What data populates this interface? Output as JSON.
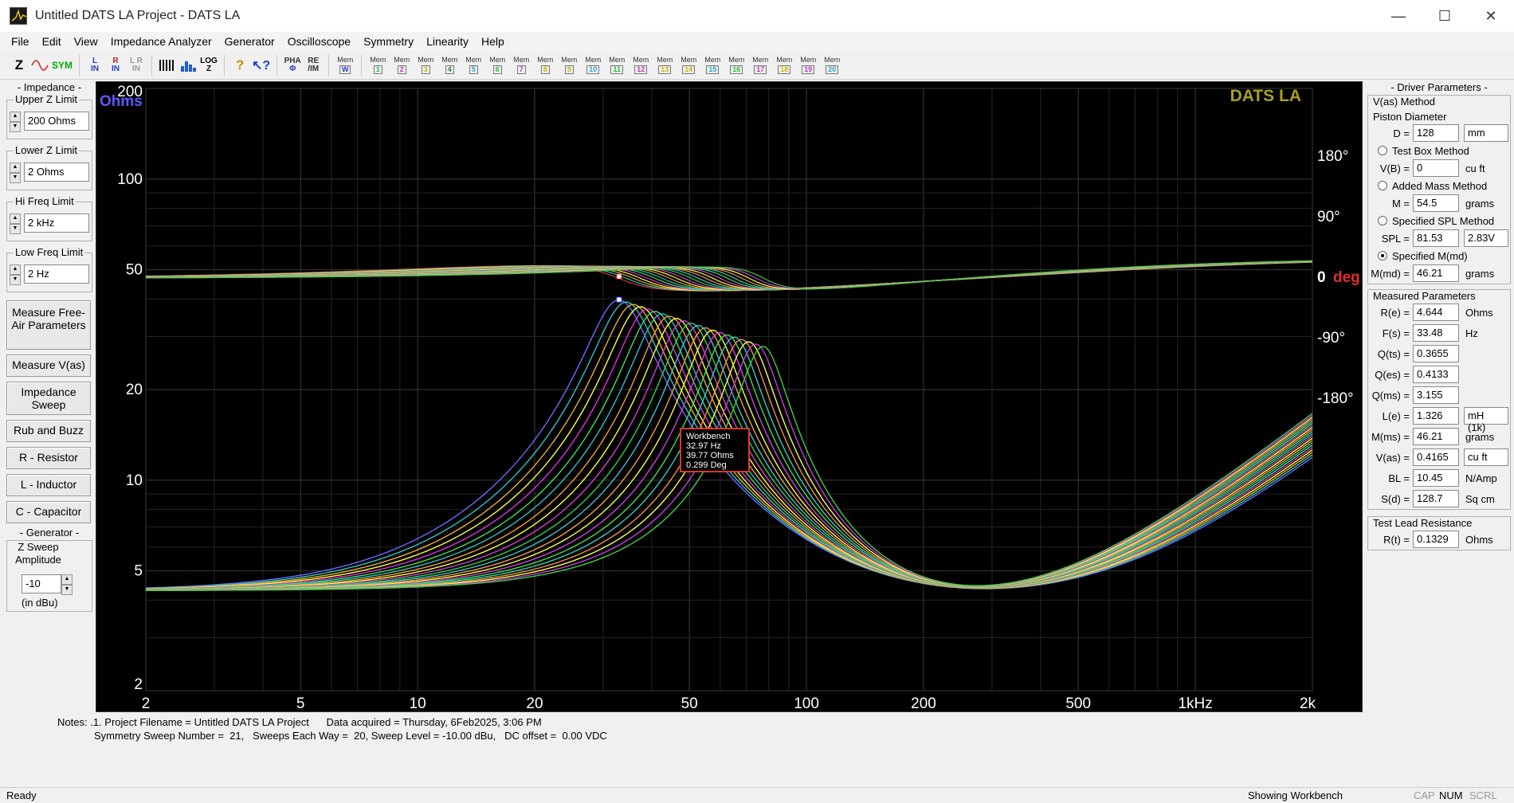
{
  "window": {
    "title": "Untitled DATS LA Project - DATS LA",
    "controls": [
      "minimize-icon",
      "maximize-icon",
      "close-icon"
    ]
  },
  "menu": [
    "File",
    "Edit",
    "View",
    "Impedance Analyzer",
    "Generator",
    "Oscilloscope",
    "Symmetry",
    "Linearity",
    "Help"
  ],
  "toolbar": {
    "z": "Z",
    "sym": "SYM",
    "l_in_top": "L",
    "l_in_bottom": "IN",
    "r_in_top": "R",
    "r_in_bottom": "IN",
    "lr_in_top": "L R",
    "lr_in_bottom": "IN",
    "log_top": "LOG",
    "log_bottom": "Z",
    "pha_top": "PHA",
    "pha_bottom": "Φ",
    "reim_top": "RE",
    "reim_bottom": "/IM",
    "mem_label": "Mem",
    "mem_w": "W",
    "mem_numbers": [
      "1",
      "2",
      "3",
      "4",
      "5",
      "6",
      "7",
      "8",
      "9",
      "10",
      "11",
      "12",
      "13",
      "14",
      "15",
      "16",
      "17",
      "18",
      "19",
      "20"
    ],
    "mem_colors": [
      "#22c43a",
      "#c03ac0",
      "#c9b800",
      "#3a7a3a",
      "#2aa8c8",
      "#22c43a",
      "#c03ac0",
      "#c9b800",
      "#c9b800",
      "#2aa8c8",
      "#22c43a",
      "#c03ac0",
      "#c9b800",
      "#c9b800",
      "#2aa8c8",
      "#22c43a",
      "#c03ac0",
      "#c9b800",
      "#c03ac0",
      "#2aa8c8"
    ]
  },
  "left": {
    "impedance_header": "- Impedance -",
    "upper_z_label": "Upper Z Limit",
    "upper_z_value": "200 Ohms",
    "lower_z_label": "Lower Z Limit",
    "lower_z_value": "2 Ohms",
    "hi_freq_label": "Hi Freq Limit",
    "hi_freq_value": "2 kHz",
    "low_freq_label": "Low Freq Limit",
    "low_freq_value": "2 Hz",
    "buttons": [
      "Measure Free-Air Parameters",
      "Measure V(as)",
      "Impedance Sweep",
      "Rub and Buzz",
      "R - Resistor",
      "L - Inductor",
      "C - Capacitor"
    ],
    "generator_header": "- Generator -",
    "z_sweep_label": "Z Sweep Amplitude",
    "amplitude_value": "-10",
    "amplitude_unit": "(in dBu)"
  },
  "plot": {
    "brand": "DATS LA",
    "y_unit_left": "Ohms",
    "phase_unit": "deg",
    "phase_zero": "0",
    "y_ticks_left": [
      "200",
      "100",
      "50",
      "20",
      "10",
      "5",
      "2"
    ],
    "y_ticks_right": [
      "180°",
      "90°",
      "-90°",
      "-180°"
    ],
    "x_ticks": [
      "2",
      "5",
      "10",
      "20",
      "50",
      "100",
      "200",
      "500",
      "1kHz",
      "2k"
    ]
  },
  "chart_data": {
    "type": "line",
    "x_scale": "log",
    "y_scale": "log",
    "xlim": [
      2,
      2000
    ],
    "ylim": [
      2,
      200
    ],
    "phase_ylim": [
      -180,
      180
    ],
    "series_count": 21,
    "series_colors": [
      "#6a6aff",
      "#2ec4c4",
      "#e8b030",
      "#ffff40",
      "#e030e0",
      "#40e060",
      "#30c0c0",
      "#f0a030",
      "#ffff40",
      "#d040d0",
      "#30d050",
      "#40c0d0",
      "#f0a040",
      "#ffff40",
      "#d040e0",
      "#40e050",
      "#30d0c0",
      "#f09040",
      "#ffff50",
      "#c040e0",
      "#40d040"
    ],
    "series_resonance_hz_first": 32.97,
    "series_resonance_ohms_first": 39.77,
    "cursor": {
      "label": "Workbench",
      "freq": "32.97 Hz",
      "ohms": "39.77 Ohms",
      "deg": "0.299 Deg"
    }
  },
  "driver": {
    "header": "- Driver Parameters -",
    "vas_method": "V(as) Method",
    "piston_diameter": "Piston Diameter",
    "d_label": "D =",
    "d_value": "128",
    "d_unit": "mm",
    "test_box": "Test Box Method",
    "vb_label": "V(B) =",
    "vb_value": "0",
    "vb_unit": "cu ft",
    "added_mass": "Added Mass Method",
    "m_label": "M =",
    "m_value": "54.5",
    "m_unit": "grams",
    "spl_method": "Specified SPL Method",
    "spl_label": "SPL =",
    "spl_value": "81.53",
    "spl_unit": "2.83V",
    "mmd_method": "Specified M(md)",
    "mmd_label": "M(md) =",
    "mmd_value": "46.21",
    "mmd_unit": "grams"
  },
  "measured": {
    "header": "Measured Parameters",
    "rows": [
      {
        "label": "R(e) =",
        "value": "4.644",
        "unit": "Ohms"
      },
      {
        "label": "F(s) =",
        "value": "33.48",
        "unit": "Hz"
      },
      {
        "label": "Q(ts) =",
        "value": "0.3655",
        "unit": ""
      },
      {
        "label": "Q(es) =",
        "value": "0.4133",
        "unit": ""
      },
      {
        "label": "Q(ms) =",
        "value": "3.155",
        "unit": ""
      },
      {
        "label": "L(e) =",
        "value": "1.326",
        "unit": "mH (1k)"
      },
      {
        "label": "M(ms) =",
        "value": "46.21",
        "unit": "grams"
      },
      {
        "label": "V(as) =",
        "value": "0.4165",
        "unit": "cu ft"
      },
      {
        "label": "BL =",
        "value": "10.45",
        "unit": "N/Amp"
      },
      {
        "label": "S(d) =",
        "value": "128.7",
        "unit": "Sq cm"
      }
    ]
  },
  "test_lead": {
    "header": "Test Lead Resistance",
    "label": "R(t) =",
    "value": "0.1329",
    "unit": "Ohms"
  },
  "notes": {
    "label": "Notes:",
    "line1": ".1. Project Filename = Untitled DATS LA Project      Data acquired = Thursday, 6Feb2025, 3:06 PM",
    "line2": "Symmetry Sweep Number =  21,   Sweeps Each Way =  20, Sweep Level = -10.00 dBu,   DC offset =  0.00 VDC"
  },
  "status": {
    "left": "Ready",
    "right": "Showing Workbench",
    "cap": "CAP",
    "num": "NUM",
    "scrl": "SCRL"
  }
}
